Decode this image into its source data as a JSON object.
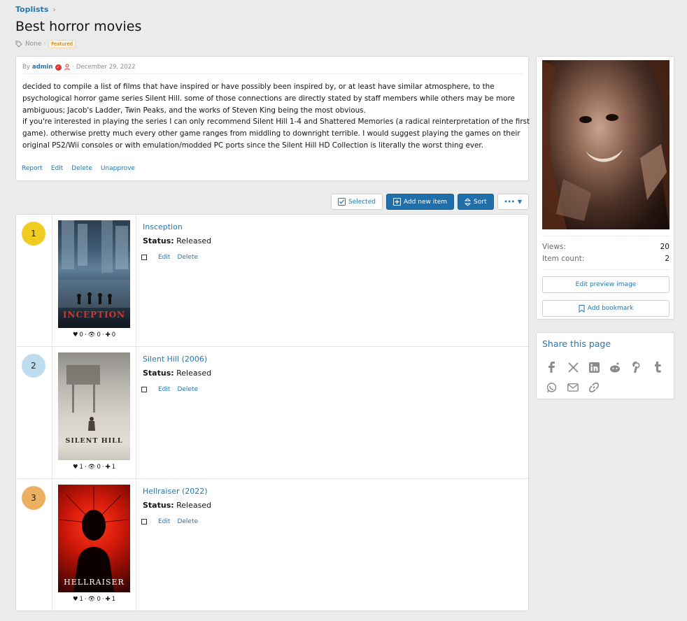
{
  "breadcrumb": {
    "item": "Toplists"
  },
  "page": {
    "title": "Best horror movies",
    "tags": "None ·",
    "badge": "Featured"
  },
  "description": {
    "by": "By",
    "author": "admin",
    "date": "· December 29, 2022",
    "paragraphs": [
      "decided to compile a list of films that have inspired or have possibly been inspired by, or at least have similar atmosphere, to the psychological horror game series Silent Hill. some of those connections are directly stated by staff members while others may be more ambiguous; Jacob's Ladder, Twin Peaks, and the works of Steven King being the most obvious.",
      "if you're interested in playing the series I can only recommend Silent Hill 1-4 and Shattered Memories (a radical reinterpretation of the first game). otherwise pretty much every other game ranges from middling to downright terrible. I would suggest playing the games on their original PS2/Wii consoles or with emulation/modded PC ports since the Silent Hill HD Collection is literally the worst thing ever."
    ],
    "actions": [
      "Report",
      "Edit",
      "Delete",
      "Unapprove"
    ]
  },
  "toolbar": {
    "selected": "Selected",
    "add": "Add new item",
    "sort": "Sort",
    "more": "•••"
  },
  "items": [
    {
      "rank": "1",
      "title": "Insception",
      "status_label": "Status:",
      "status": "Released",
      "poster_text": "INCEPTION",
      "likes": "0",
      "views": "0",
      "plus": "0",
      "edit": "Edit",
      "delete": "Delete",
      "rank_color": "#f0cb20"
    },
    {
      "rank": "2",
      "title": "Silent Hill (2006)",
      "status_label": "Status:",
      "status": "Released",
      "poster_text": "SILENT HILL",
      "likes": "1",
      "views": "0",
      "plus": "1",
      "edit": "Edit",
      "delete": "Delete",
      "rank_color": "#bfdcef"
    },
    {
      "rank": "3",
      "title": "Hellraiser (2022)",
      "status_label": "Status:",
      "status": "Released",
      "poster_text": "HELLRAISER",
      "likes": "1",
      "views": "0",
      "plus": "1",
      "edit": "Edit",
      "delete": "Delete",
      "rank_color": "#ebb062"
    }
  ],
  "sidebar": {
    "views_label": "Views:",
    "views": "20",
    "count_label": "Item count:",
    "count": "2",
    "edit_preview": "Edit preview image",
    "bookmark": "Add bookmark"
  },
  "share": {
    "title": "Share this page"
  },
  "icons": {
    "share": [
      "facebook-icon",
      "x-icon",
      "linkedin-icon",
      "reddit-icon",
      "pinterest-icon",
      "tumblr-icon",
      "whatsapp-icon",
      "email-icon",
      "link-icon"
    ]
  }
}
